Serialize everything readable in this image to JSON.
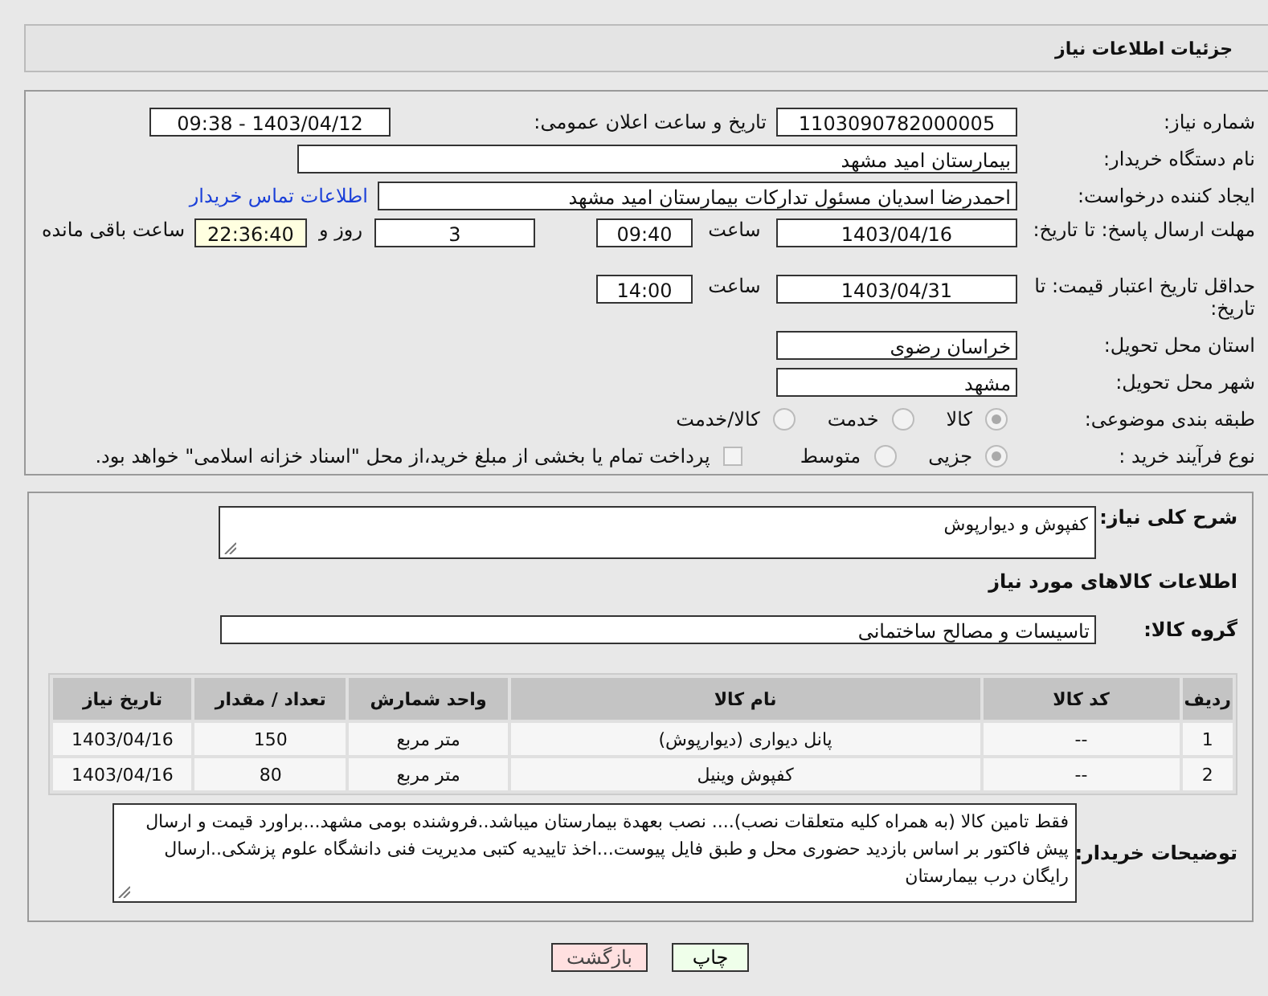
{
  "header": {
    "title": "جزئیات اطلاعات نیاز"
  },
  "need_number": {
    "label": "شماره نیاز:",
    "value": "1103090782000005"
  },
  "announce": {
    "label": "تاریخ و ساعت اعلان عمومی:",
    "value": "1403/04/12 - 09:38"
  },
  "buyer": {
    "label": "نام دستگاه خریدار:",
    "value": "بیمارستان امید مشهد"
  },
  "creator": {
    "label": "ایجاد کننده درخواست:",
    "value": "احمدرضا اسدیان مسئول تدارکات بیمارستان امید مشهد",
    "link": "اطلاعات تماس خریدار"
  },
  "reply_deadline": {
    "label": "مهلت ارسال پاسخ: تا تاریخ:",
    "date": "1403/04/16",
    "time_label": "ساعت",
    "time": "09:40",
    "days": "3",
    "days_label": "روز و",
    "remaining": "22:36:40",
    "remaining_label": "ساعت باقی مانده"
  },
  "price_validity": {
    "label": "حداقل تاریخ اعتبار قیمت: تا تاریخ:",
    "date": "1403/04/31",
    "time_label": "ساعت",
    "time": "14:00"
  },
  "province": {
    "label": "استان محل تحویل:",
    "value": "خراسان رضوی"
  },
  "city": {
    "label": "شهر محل تحویل:",
    "value": "مشهد"
  },
  "category": {
    "label": "طبقه بندی موضوعی:",
    "options": [
      {
        "label": "کالا",
        "selected": true
      },
      {
        "label": "خدمت",
        "selected": false
      },
      {
        "label": "کالا/خدمت",
        "selected": false
      }
    ]
  },
  "process": {
    "label": "نوع فرآیند خرید :",
    "options": [
      {
        "label": "جزیی",
        "selected": true
      },
      {
        "label": "متوسط",
        "selected": false
      }
    ],
    "treasury": {
      "checked": false,
      "text": "پرداخت تمام یا بخشی از مبلغ خرید،از محل \"اسناد خزانه اسلامی\" خواهد بود."
    }
  },
  "description": {
    "label": "شرح کلی نیاز:",
    "value": "کفپوش و دیوارپوش"
  },
  "section_title": "اطلاعات کالاهای مورد نیاز",
  "goods_group": {
    "label": "گروه کالا:",
    "value": "تاسیسات و مصالح ساختمانی"
  },
  "table": {
    "columns": [
      "ردیف",
      "کد کالا",
      "نام کالا",
      "واحد شمارش",
      "تعداد / مقدار",
      "تاریخ نیاز"
    ],
    "rows": [
      [
        "1",
        "--",
        "پانل دیواری (دیوارپوش)",
        "متر مربع",
        "150",
        "1403/04/16"
      ],
      [
        "2",
        "--",
        "کفپوش وینیل",
        "متر مربع",
        "80",
        "1403/04/16"
      ]
    ]
  },
  "notes": {
    "label": "توضیحات خریدار:",
    "value": "فقط تامین کالا (به همراه کلیه متعلقات نصب).... نصب بعهدة بیمارستان میباشد..فروشنده بومی مشهد...براورد قیمت و ارسال پیش فاکتور بر اساس بازدید حضوری محل و طبق فایل پیوست...اخذ تاییدیه کتبی مدیریت فنی دانشگاه علوم پزشکی..ارسال رایگان درب بیمارستان"
  },
  "buttons": [
    {
      "label": "چاپ",
      "kind": "print"
    },
    {
      "label": "بازگشت",
      "kind": "back"
    }
  ]
}
